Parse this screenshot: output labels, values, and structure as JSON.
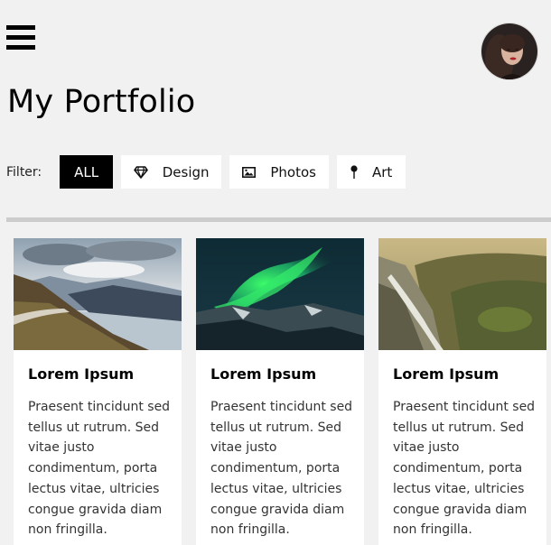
{
  "header": {
    "menu_icon": "hamburger-menu-icon",
    "avatar_icon": "user-avatar",
    "title": "My Portfolio"
  },
  "filter": {
    "label": "Filter:",
    "buttons": [
      {
        "label": "ALL",
        "icon": null,
        "active": true
      },
      {
        "label": "Design",
        "icon": "diamond-icon",
        "active": false
      },
      {
        "label": "Photos",
        "icon": "photo-icon",
        "active": false
      },
      {
        "label": "Art",
        "icon": "map-pin-icon",
        "active": false
      }
    ]
  },
  "cards": [
    {
      "image": "mountain-lake-photo",
      "title": "Lorem Ipsum",
      "text": "Praesent tincidunt sed tellus ut rutrum. Sed vitae justo condimentum, porta lectus vitae, ultricies congue gravida diam non fringilla."
    },
    {
      "image": "northern-lights-photo",
      "title": "Lorem Ipsum",
      "text": "Praesent tincidunt sed tellus ut rutrum. Sed vitae justo condimentum, porta lectus vitae, ultricies congue gravida diam non fringilla."
    },
    {
      "image": "waterfall-valley-photo",
      "title": "Lorem Ipsum",
      "text": "Praesent tincidunt sed tellus ut rutrum. Sed vitae justo condimentum, porta lectus vitae, ultricies congue gravida diam non fringilla."
    }
  ],
  "colors": {
    "background": "#f1f1f1",
    "active_filter": "#000000",
    "divider": "#cccccc",
    "card": "#ffffff"
  }
}
